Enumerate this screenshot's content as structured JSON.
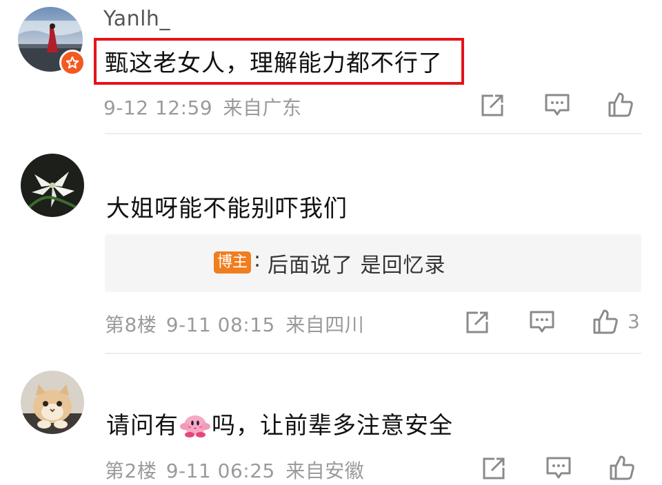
{
  "comments": [
    {
      "username": "Yanlh_",
      "text": "甄这老女人，理解能力都不行了",
      "time": "9-12 12:59",
      "location": "来自广东",
      "floor": "",
      "likes": "",
      "highlighted": true,
      "avatar_icon": "person-by-sea-avatar",
      "badge_icon": "star-badge-icon"
    },
    {
      "username": "",
      "text": "大姐呀能不能别吓我们",
      "reply": {
        "author_tag": "博主",
        "text": "后面说了 是回忆录"
      },
      "floor": "第8楼",
      "time": "9-11 08:15",
      "location": "来自四川",
      "likes": "3",
      "avatar_icon": "lily-flower-avatar"
    },
    {
      "username": "",
      "text_before": "请问有",
      "emoji_icon": "pink-kirby-emoji",
      "text_after": "吗，让前辈多注意安全",
      "floor": "第2楼",
      "time": "9-11 06:25",
      "location": "来自安徽",
      "likes": "",
      "avatar_icon": "cat-avatar"
    }
  ],
  "icons": {
    "share": "share-icon",
    "comment": "comment-icon",
    "like": "like-icon"
  },
  "colors": {
    "highlight_border": "#e5131b",
    "author_tag": "#f07d1f",
    "badge": "#f25a22",
    "meta_text": "#9a9a9a"
  }
}
